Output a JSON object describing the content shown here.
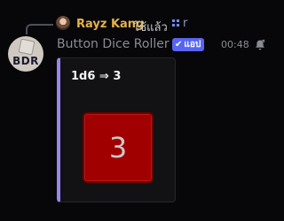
{
  "reply": {
    "author": "Rayz Kang",
    "text": "ใช้แล้ว",
    "command_icon": "slash-command-icon",
    "command": "r"
  },
  "message": {
    "bot_name": "Button Dice Roller",
    "avatar_text": "BDR",
    "badge": {
      "check": "✔",
      "label": "แอป"
    },
    "timestamp": "00:48",
    "colors": {
      "accent_bar": "#9b84ee",
      "badge": "#5865f2",
      "die": "#a00000",
      "reply_author": "#e4b24a"
    }
  },
  "embed": {
    "title": "1d6 ⇒ 3",
    "die_value": "3"
  }
}
